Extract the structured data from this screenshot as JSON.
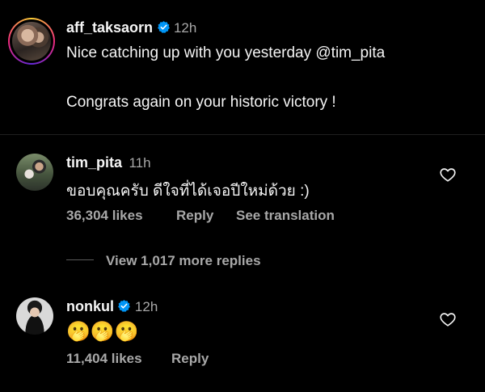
{
  "caption": {
    "username": "aff_taksaorn",
    "time": "12h",
    "line1": "Nice catching up with you yesterday @tim_pita",
    "line2": "Congrats again on your historic victory !"
  },
  "comments": [
    {
      "username": "tim_pita",
      "time": "11h",
      "text": "ขอบคุณครับ ดีใจที่ได้เจอปีใหม่ด้วย :)",
      "likes": "36,304 likes",
      "reply": "Reply",
      "translate": "See translation",
      "view_replies": "View 1,017 more replies"
    },
    {
      "username": "nonkul",
      "time": "12h",
      "text": "🫢🫢🫢",
      "likes": "11,404 likes",
      "reply": "Reply"
    }
  ],
  "colors": {
    "background": "#000000",
    "text": "#f5f5f5",
    "secondary": "#a8a8a8",
    "verified": "#0095f6"
  }
}
